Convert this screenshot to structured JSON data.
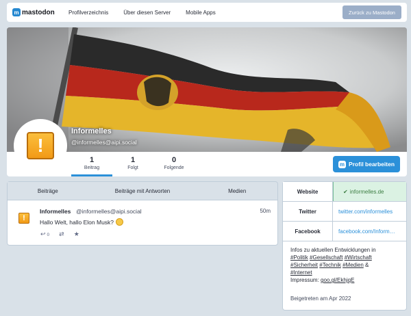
{
  "nav": {
    "logo": "mastodon",
    "links": [
      "Profilverzeichnis",
      "Über diesen Server",
      "Mobile Apps"
    ],
    "back_button": "Zurück zu Mastodon"
  },
  "profile": {
    "display_name": "Informelles",
    "handle": "@informelles@aipi.social",
    "avatar_icon": "exclamation-icon",
    "counters": [
      {
        "num": "1",
        "label": "Beitrag"
      },
      {
        "num": "1",
        "label": "Folgt"
      },
      {
        "num": "0",
        "label": "Folgende"
      }
    ],
    "edit_button": "Profil bearbeiten"
  },
  "timeline": {
    "tabs": [
      "Beiträge",
      "Beiträge mit Antworten",
      "Medien"
    ],
    "status": {
      "name": "Informelles",
      "acct": "@informelles@aipi.social",
      "time": "50m",
      "text": "Hallo Welt, hallo Elon Musk?",
      "reply_count": "0"
    }
  },
  "fields": [
    {
      "key": "Website",
      "value": "informelles.de",
      "verified": true
    },
    {
      "key": "Twitter",
      "value": "twitter.com/informelles",
      "verified": false
    },
    {
      "key": "Facebook",
      "value": "facebook.com/Inform…",
      "verified": false
    }
  ],
  "bio": {
    "line1": "Infos zu aktuellen Entwicklungen in",
    "tags1": [
      "#Politik",
      "#Gesellschaft",
      "#Wirtschaft"
    ],
    "tags2": [
      "#Sicherheit",
      "#Technik",
      "#Medien"
    ],
    "amp": "&",
    "tag3": "#Internet",
    "impressum_label": "Impressum:",
    "impressum_link": "goo.gl/EkhjqE",
    "joined": "Beigetreten am Apr 2022"
  },
  "colors": {
    "accent": "#2b90d9",
    "verified_bg": "#dbf2e3",
    "page_bg": "#d9e1e8"
  }
}
